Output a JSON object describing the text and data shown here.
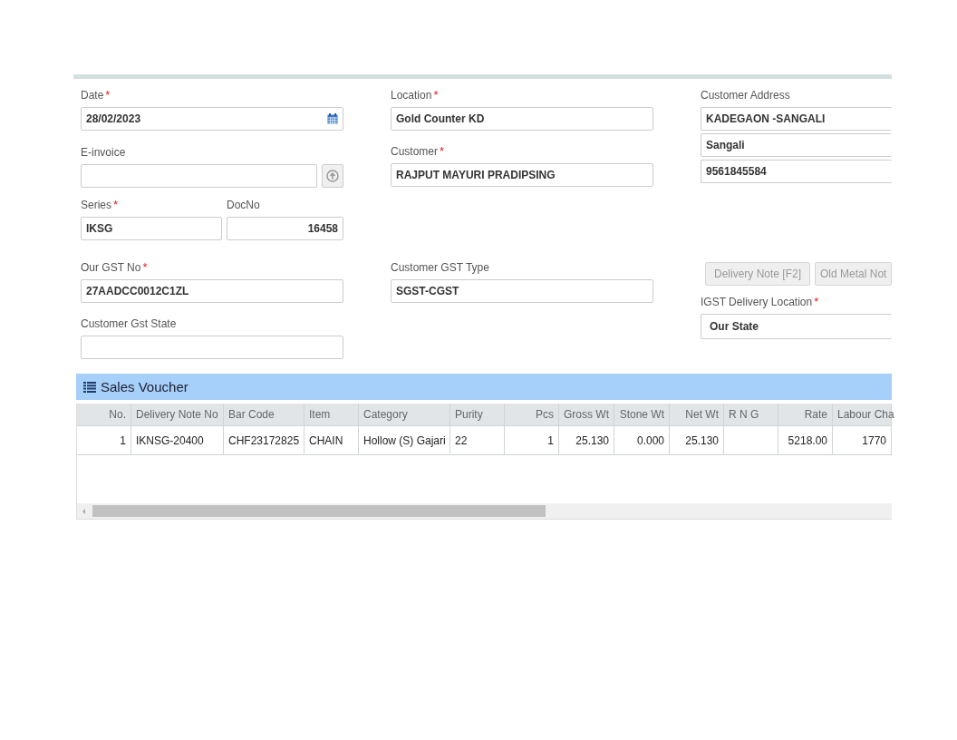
{
  "columns": [
    {
      "fields": [
        {
          "kind": "date",
          "label": "Date",
          "required_mark": "*",
          "value": "28/02/2023"
        },
        {
          "kind": "upload",
          "label": "E-invoice"
        },
        {
          "kind": "pair",
          "items": [
            {
              "kind": "text",
              "label": "Series",
              "required_mark": "*",
              "value": "IKSG"
            },
            {
              "kind": "number",
              "label": "DocNo",
              "value": "16458"
            }
          ]
        },
        {
          "kind": "text",
          "label": "Our GST No",
          "required_mark": "*",
          "value": "27AADCC0012C1ZL"
        },
        {
          "kind": "text",
          "label": "Customer Gst State"
        }
      ]
    },
    {
      "fields": [
        {
          "kind": "text",
          "label": "Location",
          "required_mark": "*",
          "value": "Gold Counter KD"
        },
        {
          "kind": "text",
          "label": "Customer",
          "required_mark": "*",
          "value": "RAJPUT MAYURI PRADIPSING"
        },
        {
          "kind": "text",
          "label": "Customer GST Type",
          "value": "SGST-CGST"
        }
      ]
    },
    {
      "fields": [
        {
          "kind": "address",
          "label": "Customer Address",
          "values": [
            "KADEGAON -SANGALI",
            "Sangali",
            "9561845584"
          ]
        },
        {
          "kind": "buttons",
          "buttons": [
            {
              "label": "Delivery Note [F2]",
              "disabled": true
            },
            {
              "label": "Old Metal Not",
              "disabled": true
            }
          ]
        },
        {
          "kind": "select",
          "label": "IGST Delivery Location",
          "required_mark": "*",
          "value": "Our State"
        }
      ]
    }
  ],
  "voucher": {
    "title": "Sales Voucher",
    "columns": [
      {
        "label": "No.",
        "kind": "number"
      },
      {
        "label": "Delivery Note No",
        "kind": "text"
      },
      {
        "label": "Bar Code",
        "kind": "text"
      },
      {
        "label": "Item",
        "kind": "text"
      },
      {
        "label": "Category",
        "kind": "text"
      },
      {
        "label": "Purity",
        "kind": "text"
      },
      {
        "label": "Pcs",
        "kind": "number"
      },
      {
        "label": "Gross Wt",
        "kind": "number"
      },
      {
        "label": "Stone Wt",
        "kind": "number"
      },
      {
        "label": "Net Wt",
        "kind": "number"
      },
      {
        "label": "R N G",
        "kind": "text"
      },
      {
        "label": "Rate",
        "kind": "number"
      },
      {
        "label": "Labour Cha",
        "kind": "number"
      }
    ],
    "rows": [
      [
        "1",
        "IKNSG-20400",
        "CHF23172825",
        "CHAIN",
        "Hollow (S) Gajari",
        "22",
        "1",
        "25.130",
        "0.000",
        "25.130",
        null,
        "5218.00",
        "1770"
      ]
    ]
  }
}
